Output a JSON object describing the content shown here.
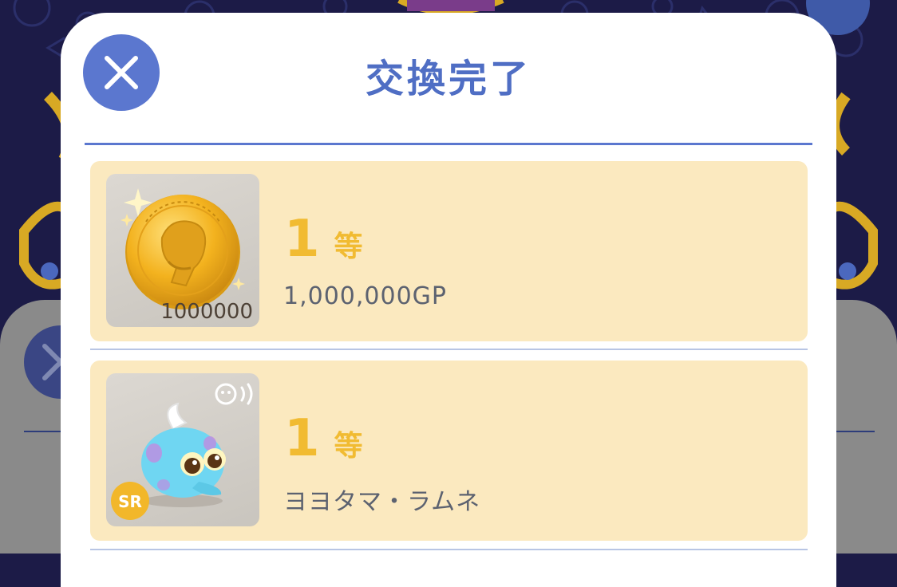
{
  "dialog": {
    "title": "交換完了"
  },
  "items": [
    {
      "rank_number": "1",
      "rank_unit": "等",
      "name": "1,000,000GP",
      "quantity": "1000000",
      "thumb_icon": "gold-coin-icon"
    },
    {
      "rank_number": "1",
      "rank_unit": "等",
      "name": "ヨヨタマ・ラムネ",
      "rarity": "SR",
      "thumb_icon": "blue-pet-icon",
      "voice_icon": "voice-icon"
    }
  ],
  "colors": {
    "accent": "#5b77cf",
    "title": "#4f6ec4",
    "card_bg": "#fbe9bf",
    "rank": "#f1bb32",
    "background": "#1c1b47"
  }
}
